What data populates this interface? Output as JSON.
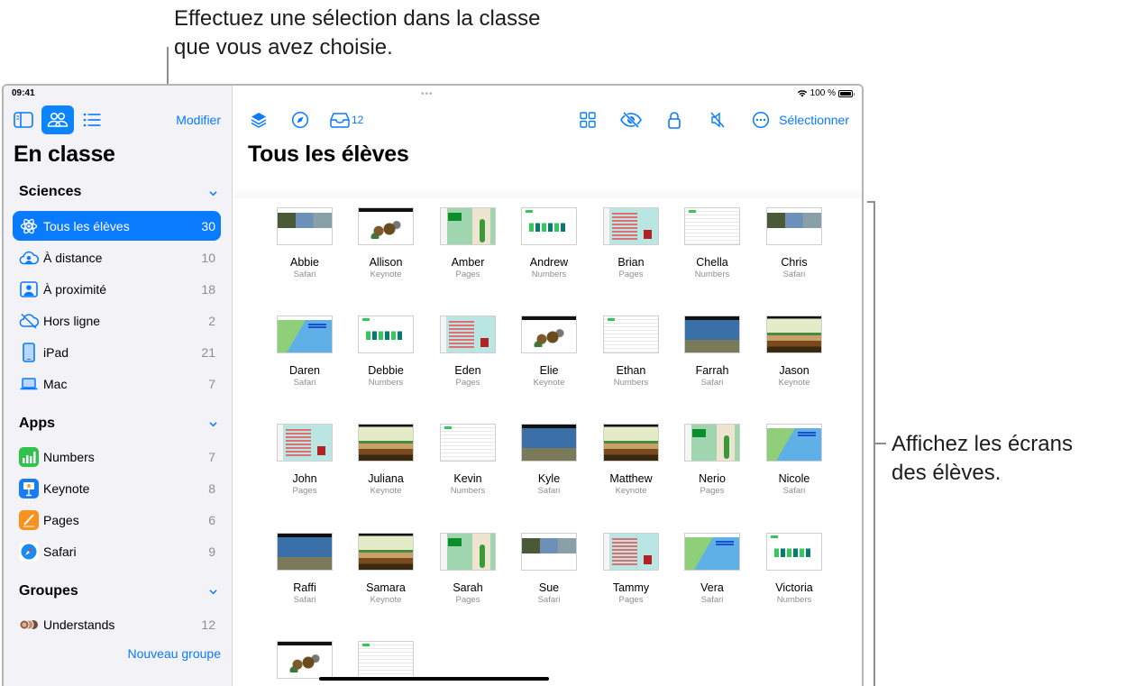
{
  "callouts": {
    "top_line1": "Effectuez une sélection dans la classe",
    "top_line2": "que vous avez choisie.",
    "right_line1": "Affichez les écrans",
    "right_line2": "des élèves."
  },
  "status_bar": {
    "time": "09:41",
    "battery": "100 %",
    "battery_level_percent": 100
  },
  "sidebar": {
    "edit_label": "Modifier",
    "title": "En classe",
    "sections": [
      {
        "title": "Sciences",
        "items": [
          {
            "label": "Tous les élèves",
            "count": "30",
            "icon": "atom-icon",
            "active": true
          },
          {
            "label": "À distance",
            "count": "10",
            "icon": "cloud-person-icon"
          },
          {
            "label": "À proximité",
            "count": "18",
            "icon": "person-square-icon"
          },
          {
            "label": "Hors ligne",
            "count": "2",
            "icon": "cloud-slash-icon"
          },
          {
            "label": "iPad",
            "count": "21",
            "icon": "ipad-icon"
          },
          {
            "label": "Mac",
            "count": "7",
            "icon": "laptop-icon"
          }
        ]
      },
      {
        "title": "Apps",
        "items": [
          {
            "label": "Numbers",
            "count": "7",
            "icon": "numbers-app-icon"
          },
          {
            "label": "Keynote",
            "count": "8",
            "icon": "keynote-app-icon"
          },
          {
            "label": "Pages",
            "count": "6",
            "icon": "pages-app-icon"
          },
          {
            "label": "Safari",
            "count": "9",
            "icon": "safari-app-icon"
          }
        ]
      },
      {
        "title": "Groupes",
        "items": [
          {
            "label": "Understands",
            "count": "12",
            "icon": "group-avatars-icon"
          }
        ]
      }
    ],
    "new_group_label": "Nouveau groupe"
  },
  "main": {
    "title": "Tous les élèves",
    "inbox_count": "12",
    "select_label": "Sélectionner",
    "toolbar_icons": [
      "layers-icon",
      "compass-icon",
      "inbox-icon",
      "grid-icon",
      "eye-slash-icon",
      "lock-icon",
      "speaker-mute-icon",
      "more-icon"
    ],
    "students": [
      {
        "name": "Abbie",
        "app": "Safari",
        "screen": "safari-forest"
      },
      {
        "name": "Allison",
        "app": "Keynote",
        "screen": "keynote-food"
      },
      {
        "name": "Amber",
        "app": "Pages",
        "screen": "pages-cactus"
      },
      {
        "name": "Andrew",
        "app": "Numbers",
        "screen": "numbers-chart"
      },
      {
        "name": "Brian",
        "app": "Pages",
        "screen": "pages-plant"
      },
      {
        "name": "Chella",
        "app": "Numbers",
        "screen": "numbers-doc"
      },
      {
        "name": "Chris",
        "app": "Safari",
        "screen": "safari-forest"
      },
      {
        "name": "Daren",
        "app": "Safari",
        "screen": "safari-reef"
      },
      {
        "name": "Debbie",
        "app": "Numbers",
        "screen": "numbers-chart"
      },
      {
        "name": "Eden",
        "app": "Pages",
        "screen": "pages-plant"
      },
      {
        "name": "Elie",
        "app": "Keynote",
        "screen": "keynote-food"
      },
      {
        "name": "Ethan",
        "app": "Numbers",
        "screen": "numbers-doc"
      },
      {
        "name": "Farrah",
        "app": "Safari",
        "screen": "safari-energy"
      },
      {
        "name": "Jason",
        "app": "Keynote",
        "screen": "keynote-earth"
      },
      {
        "name": "John",
        "app": "Pages",
        "screen": "pages-plant"
      },
      {
        "name": "Juliana",
        "app": "Keynote",
        "screen": "keynote-earth"
      },
      {
        "name": "Kevin",
        "app": "Numbers",
        "screen": "numbers-doc"
      },
      {
        "name": "Kyle",
        "app": "Safari",
        "screen": "safari-energy"
      },
      {
        "name": "Matthew",
        "app": "Keynote",
        "screen": "keynote-earth"
      },
      {
        "name": "Nerio",
        "app": "Pages",
        "screen": "pages-cactus"
      },
      {
        "name": "Nicole",
        "app": "Safari",
        "screen": "safari-reef"
      },
      {
        "name": "Raffi",
        "app": "Safari",
        "screen": "safari-energy"
      },
      {
        "name": "Samara",
        "app": "Keynote",
        "screen": "keynote-earth"
      },
      {
        "name": "Sarah",
        "app": "Pages",
        "screen": "pages-cactus"
      },
      {
        "name": "Sue",
        "app": "Safari",
        "screen": "safari-forest"
      },
      {
        "name": "Tammy",
        "app": "Pages",
        "screen": "pages-plant"
      },
      {
        "name": "Vera",
        "app": "Safari",
        "screen": "safari-reef"
      },
      {
        "name": "Victoria",
        "app": "Numbers",
        "screen": "numbers-chart"
      },
      {
        "name": "",
        "app": "",
        "screen": "keynote-food"
      },
      {
        "name": "",
        "app": "",
        "screen": "numbers-doc"
      }
    ]
  },
  "colors": {
    "accent": "#0a7aff",
    "sidebar_bg": "#f2f2f7",
    "secondary_text": "#8e8e93"
  }
}
